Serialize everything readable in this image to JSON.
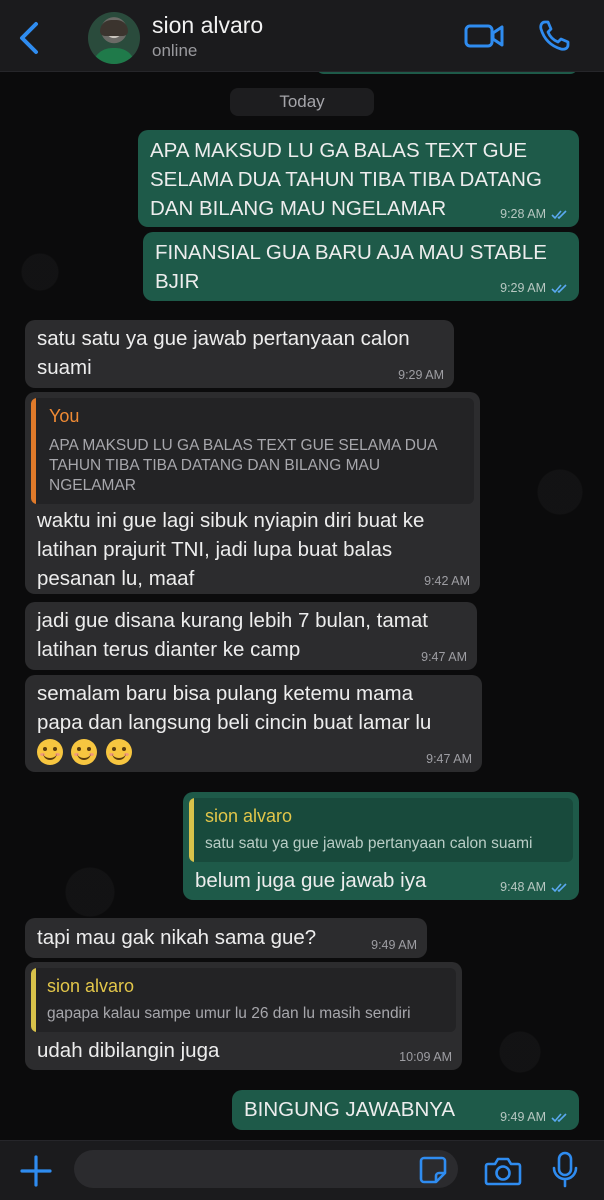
{
  "header": {
    "contact_name": "sion alvaro",
    "status": "online"
  },
  "chat": {
    "date_label": "Today",
    "messages": [
      {
        "direction": "out",
        "lines": [
          "APA MAKSUD LU GA BALAS TEXT GUE",
          "SELAMA DUA TAHUN TIBA TIBA DATANG",
          "DAN BILANG MAU NGELAMAR"
        ],
        "time": "9:28 AM",
        "read": true
      },
      {
        "direction": "out",
        "lines": [
          "FINANSIAL GUA BARU AJA MAU STABLE",
          "BJIR"
        ],
        "time": "9:29 AM",
        "read": true
      },
      {
        "direction": "in",
        "lines": [
          "satu satu ya gue jawab pertanyaan calon",
          "suami"
        ],
        "time": "9:29 AM"
      },
      {
        "direction": "in",
        "reply_to": {
          "name": "You",
          "lines": [
            "APA MAKSUD LU GA BALAS TEXT GUE SELAMA DUA",
            "TAHUN TIBA TIBA DATANG DAN BILANG MAU",
            "NGELAMAR"
          ]
        },
        "lines": [
          "waktu ini gue lagi sibuk nyiapin diri buat ke",
          "latihan prajurit TNI, jadi lupa buat balas",
          "pesanan lu, maaf"
        ],
        "time": "9:42 AM"
      },
      {
        "direction": "in",
        "lines": [
          "jadi gue disana kurang lebih 7 bulan, tamat",
          "latihan terus dianter ke camp"
        ],
        "time": "9:47 AM"
      },
      {
        "direction": "in",
        "lines": [
          "semalam baru bisa pulang ketemu mama",
          "papa dan langsung beli cincin buat lamar lu"
        ],
        "emoji_count": 3,
        "time": "9:47 AM"
      },
      {
        "direction": "out",
        "reply_to": {
          "name": "sion alvaro",
          "lines": [
            "satu satu ya gue jawab pertanyaan calon suami"
          ]
        },
        "lines": [
          "belum juga gue jawab iya"
        ],
        "time": "9:48 AM",
        "read": true
      },
      {
        "direction": "in",
        "lines": [
          "tapi mau gak nikah sama gue?"
        ],
        "time": "9:49 AM"
      },
      {
        "direction": "in",
        "reply_to": {
          "name": "sion alvaro",
          "lines": [
            "gapapa kalau sampe umur lu 26 dan lu masih sendiri"
          ]
        },
        "lines": [
          "udah dibilangin juga"
        ],
        "time": "10:09 AM"
      },
      {
        "direction": "out",
        "lines": [
          "BINGUNG JAWABNYA"
        ],
        "time": "9:49 AM",
        "read": true
      }
    ]
  },
  "composer": {
    "input_value": "",
    "placeholder": ""
  },
  "icons": {
    "back": "chevron-left-icon",
    "video": "video-camera-icon",
    "call": "phone-icon",
    "add": "plus-icon",
    "sticker": "sticker-icon",
    "camera": "camera-icon",
    "mic": "microphone-icon",
    "read_receipt": "double-check-icon"
  },
  "colors": {
    "accent": "#2f8cf0",
    "outgoing_bubble": "#1e5a49",
    "incoming_bubble": "#2c2c2e",
    "read_ticks": "#5aa9f0"
  }
}
